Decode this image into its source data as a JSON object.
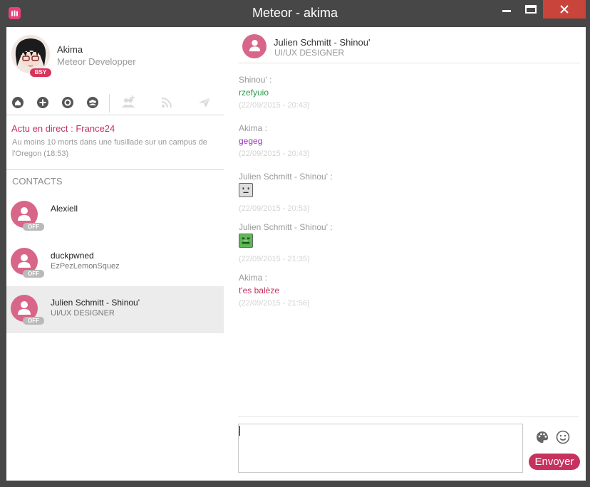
{
  "window": {
    "title": "Meteor - akima"
  },
  "profile": {
    "name": "Akima",
    "role": "Meteor Developper",
    "status": "BSY"
  },
  "toolbar": {
    "icons": [
      "home-icon",
      "add-icon",
      "settings-icon",
      "group-icon",
      "add-group-icon",
      "feed-icon",
      "send-icon"
    ]
  },
  "news": {
    "label": "Actu en direct :",
    "source": "France24",
    "text": "Au moins 10 morts dans une fusillade sur un campus de l'Oregon (18:53)"
  },
  "contacts": {
    "title": "CONTACTS",
    "items": [
      {
        "name": "Alexiell",
        "subtitle": "",
        "status": "OFF"
      },
      {
        "name": "duckpwned",
        "subtitle": "EzPezLemonSquez",
        "status": "OFF"
      },
      {
        "name": "Julien Schmitt - Shinou'",
        "subtitle": "UI/UX DESIGNER",
        "status": "OFF"
      }
    ]
  },
  "chat": {
    "name": "Julien Schmitt - Shinou'",
    "role": "UI/UX DESIGNER",
    "messages": [
      {
        "author": "Shinou' :",
        "text": "rzefyuio",
        "time": "(22/09/2015 - 20:43)"
      },
      {
        "author": "Akima :",
        "text": "gegeg",
        "time": "(22/09/2015 - 20:43)"
      },
      {
        "author": "Julien Schmitt - Shinou' :",
        "emoji": "neutral-face",
        "time": "(22/09/2015 - 20:53)"
      },
      {
        "author": "Julien Schmitt - Shinou' :",
        "emoji": "frog-face",
        "time": "(22/09/2015 - 21:35)"
      },
      {
        "author": "Akima :",
        "text": "t'es balèze",
        "time": "(22/09/2015 - 21:56)"
      }
    ]
  },
  "composer": {
    "value": "",
    "send_label": "Envoyer"
  },
  "colors": {
    "accent": "#c6325d",
    "avatar": "#d86688",
    "msg_green": "#2d9a47",
    "msg_purple": "#9b30c4",
    "msg_pink": "#c6325d",
    "close": "#c9453c"
  }
}
